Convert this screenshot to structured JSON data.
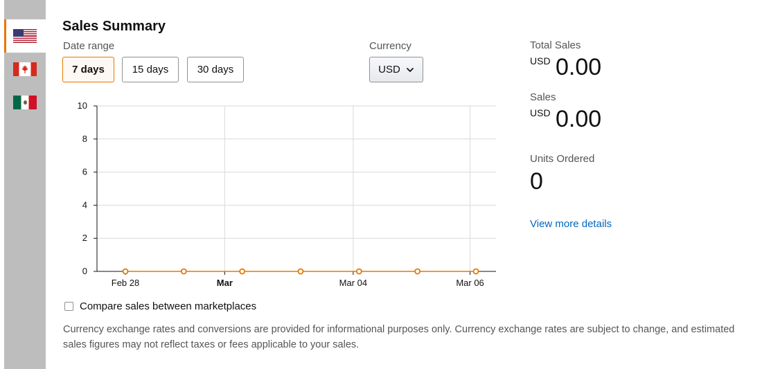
{
  "flags": [
    {
      "name": "United States",
      "icon": "us-flag-icon",
      "active": true
    },
    {
      "name": "Canada",
      "icon": "canada-flag-icon",
      "active": false
    },
    {
      "name": "Mexico",
      "icon": "mexico-flag-icon",
      "active": false
    }
  ],
  "summary": {
    "title": "Sales Summary",
    "date_range_label": "Date range",
    "ranges": [
      "7 days",
      "15 days",
      "30 days"
    ],
    "selected_range": "7 days",
    "currency_label": "Currency",
    "currency_value": "USD"
  },
  "metrics": {
    "total_sales_label": "Total Sales",
    "total_sales_currency": "USD",
    "total_sales_value": "0.00",
    "sales_label": "Sales",
    "sales_currency": "USD",
    "sales_value": "0.00",
    "units_label": "Units Ordered",
    "units_value": "0",
    "details_link": "View more details"
  },
  "compare_label": "Compare sales between marketplaces",
  "compare_checked": false,
  "disclaimer": "Currency exchange rates and conversions are provided for informational purposes only. Currency exchange rates are subject to change, and estimated sales figures may not reflect taxes or fees applicable to your sales.",
  "colors": {
    "accent": "#e77600",
    "link": "#0066c0",
    "rail": "#bdbdbd",
    "series": "#e77600"
  },
  "chart_data": {
    "type": "line",
    "x": [
      "Feb 28",
      "Mar 01",
      "Mar 02",
      "Mar 03",
      "Mar 04",
      "Mar 05",
      "Mar 06"
    ],
    "x_tick_labels": [
      {
        "label": "Feb 28",
        "index": 0,
        "bold": false
      },
      {
        "label": "Mar",
        "index": 1.7,
        "bold": true
      },
      {
        "label": "Mar 04",
        "index": 3.9,
        "bold": false
      },
      {
        "label": "Mar 06",
        "index": 5.9,
        "bold": false
      }
    ],
    "series": [
      {
        "values": [
          0,
          0,
          0,
          0,
          0,
          0,
          0
        ]
      }
    ],
    "ylim": [
      0,
      10
    ],
    "y_ticks": [
      0,
      2,
      4,
      6,
      8,
      10
    ],
    "grid": true,
    "title": "",
    "xlabel": "",
    "ylabel": ""
  }
}
